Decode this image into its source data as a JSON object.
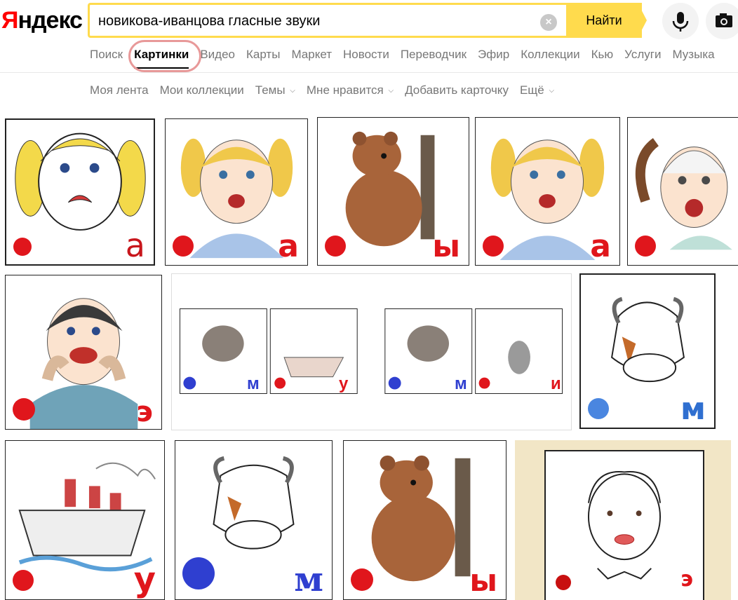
{
  "header": {
    "logo_first": "Я",
    "logo_rest": "ндекс",
    "search_value": "новикова-иванцова гласные звуки",
    "clear_label": "×",
    "find_label": "Найти"
  },
  "nav": {
    "tabs": [
      "Поиск",
      "Картинки",
      "Видео",
      "Карты",
      "Маркет",
      "Новости",
      "Переводчик",
      "Эфир",
      "Коллекции",
      "Кью",
      "Услуги",
      "Музыка"
    ]
  },
  "subnav": {
    "items": [
      "Моя лента",
      "Мои коллекции",
      "Темы",
      "Мне нравится",
      "Добавить карточку",
      "Ещё"
    ],
    "caret": "⌵"
  },
  "results": {
    "row1": [
      {
        "letter": "а",
        "subject": "crying-girl-sketch"
      },
      {
        "letter": "а",
        "subject": "crying-girl"
      },
      {
        "letter": "ы",
        "subject": "bear"
      },
      {
        "letter": "а",
        "subject": "crying-girl"
      },
      {
        "letter": "",
        "subject": "girl-toothache"
      }
    ],
    "row2": [
      {
        "letter": "э",
        "subject": "boy-calling"
      },
      {
        "letters": [
          "м",
          "у",
          "м",
          "и"
        ],
        "subject": "strip-cow-ship-cow-hare"
      },
      {
        "letter": "м",
        "subject": "cow"
      }
    ],
    "row3": [
      {
        "letter": "у",
        "subject": "ship"
      },
      {
        "letter": "м",
        "subject": "cow"
      },
      {
        "letter": "ы",
        "subject": "bear"
      },
      {
        "letter": "э",
        "subject": "boy-face"
      }
    ]
  },
  "colors": {
    "brand_yellow": "#ffdb4d",
    "red_vowel": "#e0161c",
    "blue_consonant": "#2f3fd0"
  }
}
